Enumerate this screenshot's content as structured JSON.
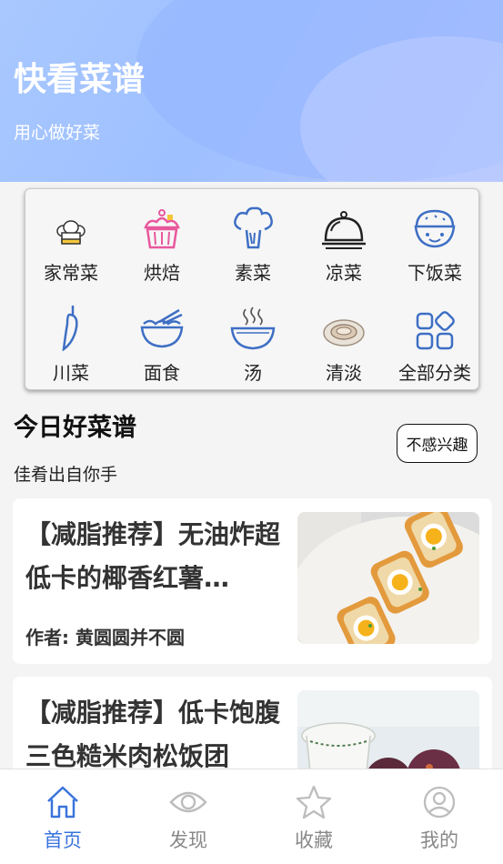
{
  "header": {
    "title": "快看菜谱",
    "subtitle": "用心做好菜"
  },
  "categories": [
    {
      "label": "家常菜",
      "icon": "chef-hat-icon"
    },
    {
      "label": "烘焙",
      "icon": "cake-icon"
    },
    {
      "label": "素菜",
      "icon": "broccoli-icon"
    },
    {
      "label": "凉菜",
      "icon": "cloche-icon"
    },
    {
      "label": "下饭菜",
      "icon": "rice-bowl-icon"
    },
    {
      "label": "川菜",
      "icon": "chili-icon"
    },
    {
      "label": "面食",
      "icon": "noodle-bowl-icon"
    },
    {
      "label": "汤",
      "icon": "soup-bowl-icon"
    },
    {
      "label": "清淡",
      "icon": "plate-icon"
    },
    {
      "label": "全部分类",
      "icon": "grid-icon"
    }
  ],
  "section": {
    "title": "今日好菜谱",
    "subtitle": "佳肴出自你手",
    "not_interested": "不感兴趣"
  },
  "recipes": [
    {
      "title": "【减脂推荐】无油炸超低卡的椰香红薯…",
      "author": "作者: 黄圆圆并不圆"
    },
    {
      "title": "【减脂推荐】低卡饱腹三色糙米肉松饭团",
      "author": ""
    }
  ],
  "tabs": [
    {
      "label": "首页",
      "icon": "home-icon",
      "active": true
    },
    {
      "label": "发现",
      "icon": "eye-icon",
      "active": false
    },
    {
      "label": "收藏",
      "icon": "star-icon",
      "active": false
    },
    {
      "label": "我的",
      "icon": "user-icon",
      "active": false
    }
  ],
  "colors": {
    "accent": "#3a74dc",
    "header_gradient_start": "#a9c8ff",
    "header_gradient_end": "#b6c6ff"
  }
}
